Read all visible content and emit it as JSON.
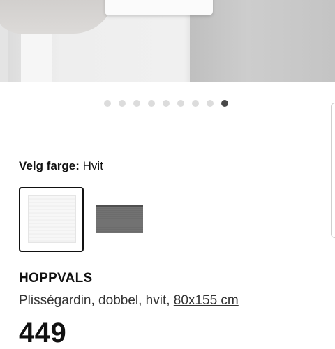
{
  "gallery": {
    "dot_count": 9,
    "active_index": 8
  },
  "color_selector": {
    "label": "Velg farge:",
    "selected_value": "Hvit",
    "options": [
      {
        "name": "white-swatch",
        "color": "#f5f5f5",
        "selected": true
      },
      {
        "name": "grey-swatch",
        "color": "#6f6f6f",
        "selected": false
      }
    ]
  },
  "product": {
    "name": "HOPPVALS",
    "description": "Plisségardin, dobbel, hvit,",
    "size": "80x155 cm",
    "price": "449"
  }
}
